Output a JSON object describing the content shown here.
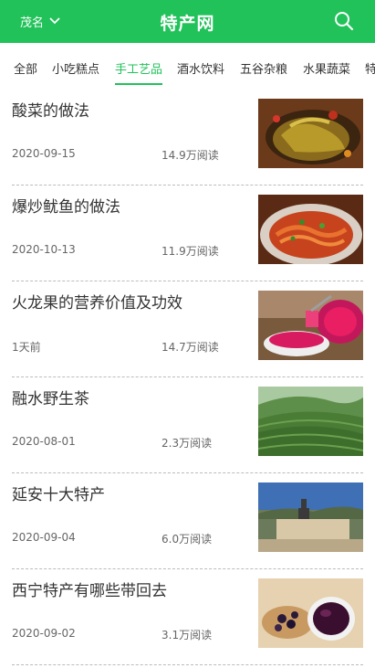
{
  "header": {
    "city": "茂名",
    "title": "特产网"
  },
  "tabs": [
    {
      "label": "全部"
    },
    {
      "label": "小吃糕点"
    },
    {
      "label": "手工艺品",
      "active": true
    },
    {
      "label": "酒水饮料"
    },
    {
      "label": "五谷杂粮"
    },
    {
      "label": "水果蔬菜"
    },
    {
      "label": "特"
    }
  ],
  "articles": [
    {
      "title": "酸菜的做法",
      "date": "2020-09-15",
      "reads": "14.9万阅读",
      "image": "pickled-vegetables-photo"
    },
    {
      "title": "爆炒鱿鱼的做法",
      "date": "2020-10-13",
      "reads": "11.9万阅读",
      "image": "stir-fried-squid-photo"
    },
    {
      "title": "火龙果的营养价值及功效",
      "date": "1天前",
      "reads": "14.7万阅读",
      "image": "dragon-fruit-photo"
    },
    {
      "title": "融水野生茶",
      "date": "2020-08-01",
      "reads": "2.3万阅读",
      "image": "tea-plantation-photo"
    },
    {
      "title": "延安十大特产",
      "date": "2020-09-04",
      "reads": "6.0万阅读",
      "image": "yanan-monument-photo"
    },
    {
      "title": "西宁特产有哪些带回去",
      "date": "2020-09-02",
      "reads": "3.1万阅读",
      "image": "berries-and-juice-photo"
    }
  ],
  "colors": {
    "brand": "#21c25a",
    "text": "#333333",
    "muted": "#666666"
  }
}
